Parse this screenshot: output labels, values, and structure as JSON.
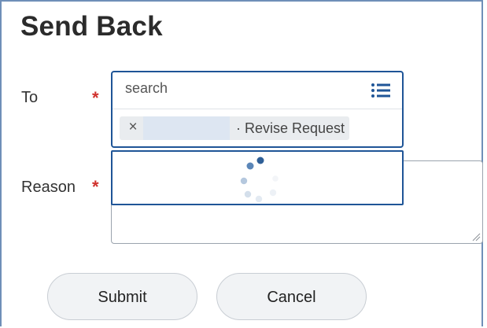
{
  "dialog": {
    "title": "Send Back"
  },
  "form": {
    "to_label": "To",
    "required_mark": "*",
    "reason_label": "Reason",
    "search": {
      "placeholder": "search",
      "value": ""
    },
    "selected_item": {
      "remove_glyph": "×",
      "text": "· Revise Request"
    },
    "reason_value": ""
  },
  "buttons": {
    "submit_label": "Submit",
    "cancel_label": "Cancel"
  },
  "colors": {
    "accent_border": "#1f5597",
    "required": "#d0312d",
    "list_icon": "#1f5597",
    "spinner": "#5b86b8"
  },
  "icons": {
    "list": "list-icon",
    "remove": "close-icon",
    "loading": "spinner-icon",
    "resize": "resize-grip-icon"
  }
}
